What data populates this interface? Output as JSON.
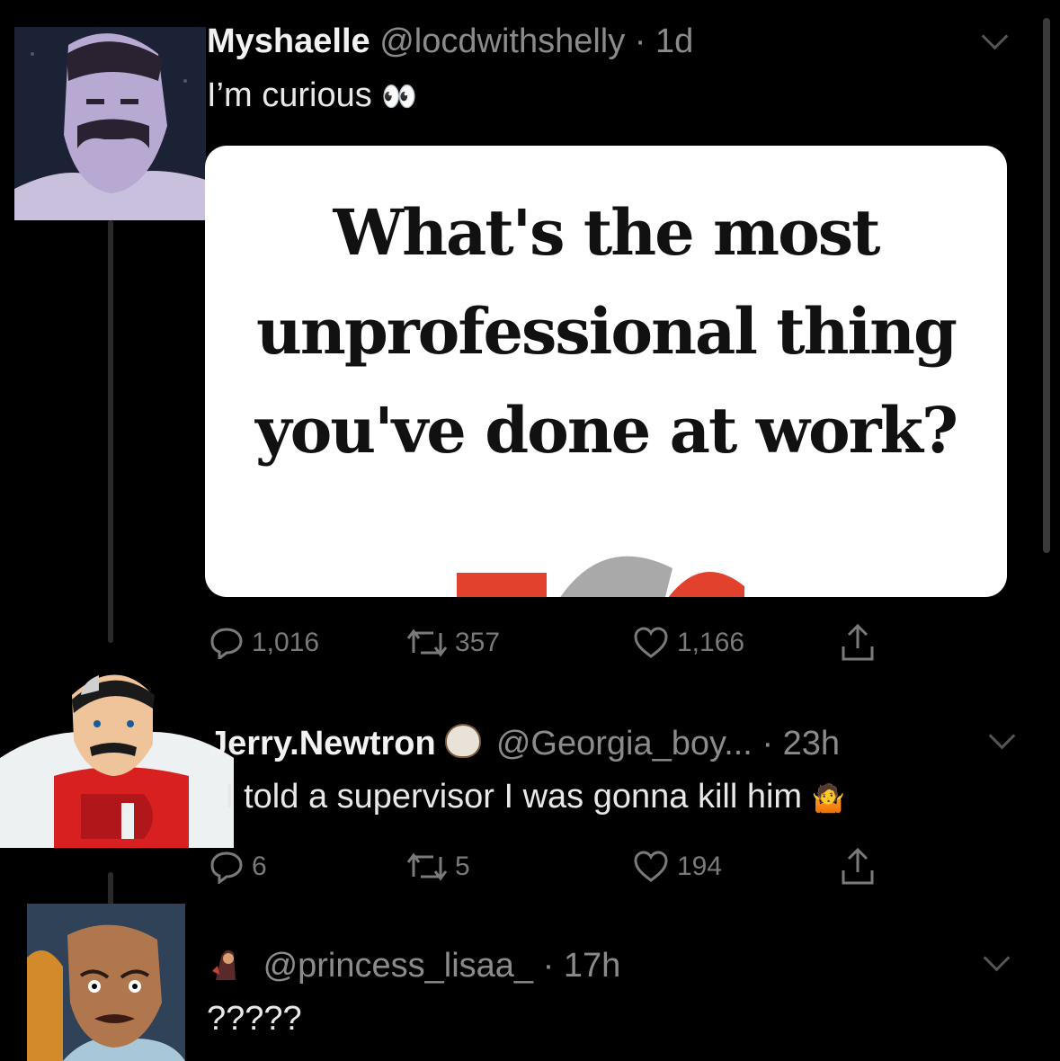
{
  "tweet1": {
    "display_name": "Myshaelle",
    "handle": "@locdwithshelly",
    "time": "· 1d",
    "text": "I’m curious",
    "emoji": "👀",
    "card_lines": [
      "What's the most",
      "unprofessional thing",
      "you've done at work?"
    ],
    "replies": "1,016",
    "retweets": "357",
    "likes": "1,166"
  },
  "tweet2": {
    "display_name": "Jerry.Newtron",
    "handle": "@Georgia_boy...",
    "time": "· 23h",
    "text": "I told a supervisor I was gonna kill him",
    "emoji": "🤷",
    "replies": "6",
    "retweets": "5",
    "likes": "194"
  },
  "tweet3": {
    "handle": "@princess_lisaa_",
    "time": "· 17h",
    "text": "?????"
  },
  "icons": {
    "reply": "reply-icon",
    "retweet": "retweet-icon",
    "like": "heart-icon",
    "share": "share-icon",
    "more": "chevron-down-icon"
  },
  "colors": {
    "background": "#000000",
    "text": "#e8e8e8",
    "muted": "#8b8b8b",
    "card": "#ffffff"
  }
}
